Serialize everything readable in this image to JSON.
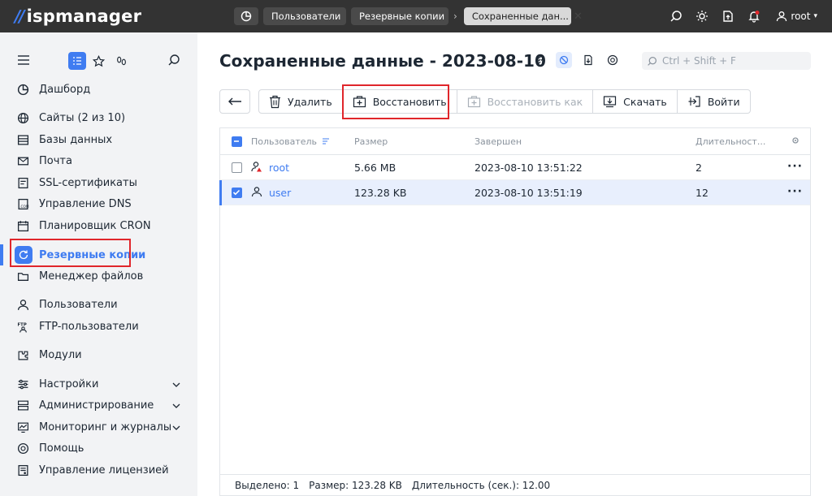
{
  "app": {
    "logo_text": "ispmanager"
  },
  "topbar": {
    "crumbs": [
      "Пользователи",
      "Резервные копии",
      "Сохраненные дан..."
    ],
    "user": "root"
  },
  "sidebar": {
    "items": [
      {
        "label": "Дашборд",
        "icon": "dashboard-icon"
      },
      {
        "label": "Сайты (2 из 10)",
        "icon": "globe-icon"
      },
      {
        "label": "Базы данных",
        "icon": "database-icon"
      },
      {
        "label": "Почта",
        "icon": "mail-icon"
      },
      {
        "label": "SSL-сертификаты",
        "icon": "certificate-icon"
      },
      {
        "label": "Управление DNS",
        "icon": "dns-icon"
      },
      {
        "label": "Планировщик CRON",
        "icon": "calendar-icon"
      },
      {
        "label": "Резервные копии",
        "icon": "backup-icon"
      },
      {
        "label": "Менеджер файлов",
        "icon": "folder-icon"
      },
      {
        "label": "Пользователи",
        "icon": "user-icon"
      },
      {
        "label": "FTP-пользователи",
        "icon": "ftp-icon"
      },
      {
        "label": "Модули",
        "icon": "modules-icon"
      },
      {
        "label": "Настройки",
        "icon": "settings-icon"
      },
      {
        "label": "Администрирование",
        "icon": "admin-icon"
      },
      {
        "label": "Мониторинг и журналы",
        "icon": "monitoring-icon"
      },
      {
        "label": "Помощь",
        "icon": "help-icon"
      },
      {
        "label": "Управление лицензией",
        "icon": "license-icon"
      }
    ]
  },
  "main": {
    "title": "Сохраненные данные - 2023-08-10",
    "search_placeholder": "Ctrl + Shift + F",
    "toolbar": {
      "delete": "Удалить",
      "restore": "Восстановить",
      "restore_as": "Восстановить как",
      "download": "Скачать",
      "login": "Войти"
    },
    "table": {
      "columns": [
        "Пользователь",
        "Размер",
        "Завершен",
        "Длительност..."
      ],
      "rows": [
        {
          "user": "root",
          "size": "5.66 MB",
          "finished": "2023-08-10 13:51:22",
          "duration": "2",
          "checked": false
        },
        {
          "user": "user",
          "size": "123.28 KB",
          "finished": "2023-08-10 13:51:19",
          "duration": "12",
          "checked": true
        }
      ]
    },
    "footer": {
      "selected": "Выделено: 1",
      "size": "Размер: 123.28 KB",
      "duration": "Длительность (сек.): 12.00"
    }
  },
  "colors": {
    "accent": "#3f7cf1",
    "topbar": "#333333",
    "highlight": "#e0262b"
  }
}
